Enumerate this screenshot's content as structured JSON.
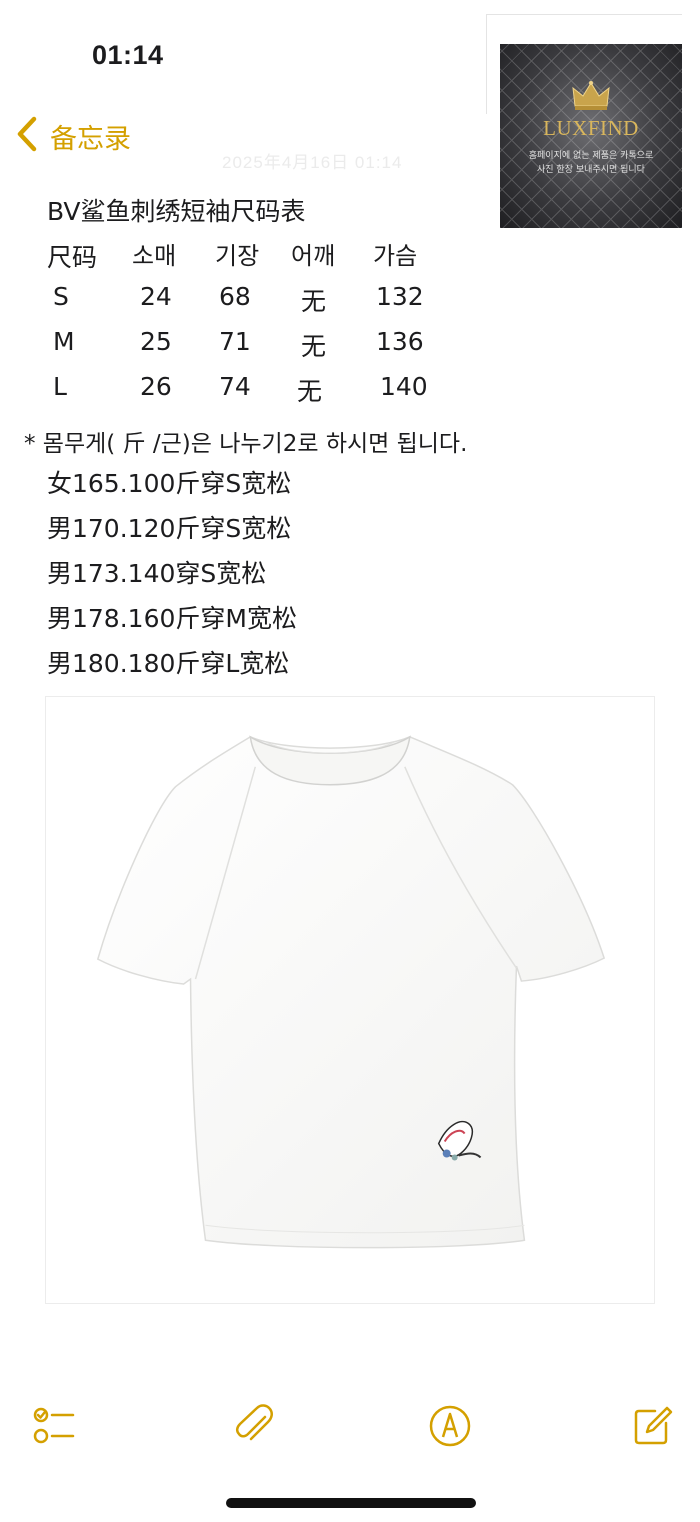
{
  "status_bar": {
    "time": "01:14"
  },
  "nav": {
    "back_label": "备忘录",
    "date": "2025年4月16日 01:14"
  },
  "watermark": {
    "name": "LUXFIND",
    "line1": "홈페이지에 없는 제품은 카톡으로",
    "line2": "사진 한장 보내주시면 됩니다"
  },
  "note": {
    "title": "BV鲨鱼刺绣短袖尺码表",
    "table": {
      "headers": [
        "尺码",
        "소매",
        "기장",
        "어깨",
        "가슴"
      ],
      "rows": [
        [
          "S",
          "24",
          "68",
          "无",
          "132"
        ],
        [
          "M",
          "25",
          "71",
          "无",
          "136"
        ],
        [
          "L",
          "26",
          "74",
          "无",
          "140"
        ]
      ]
    },
    "weight_note": "* 몸무게( 斤 /근)은 나누기2로 하시면 됩니다.",
    "recommendations": [
      "女165.100斤穿S宽松",
      "男170.120斤穿S宽松",
      "男173.140穿S宽松",
      "男178.160斤穿M宽松",
      "男180.180斤穿L宽松"
    ]
  },
  "toolbar": {
    "icons": [
      "checklist-icon",
      "paperclip-icon",
      "markup-pen-icon",
      "compose-icon"
    ]
  },
  "colors": {
    "accent": "#d4a000",
    "text": "#1c1c1e"
  }
}
